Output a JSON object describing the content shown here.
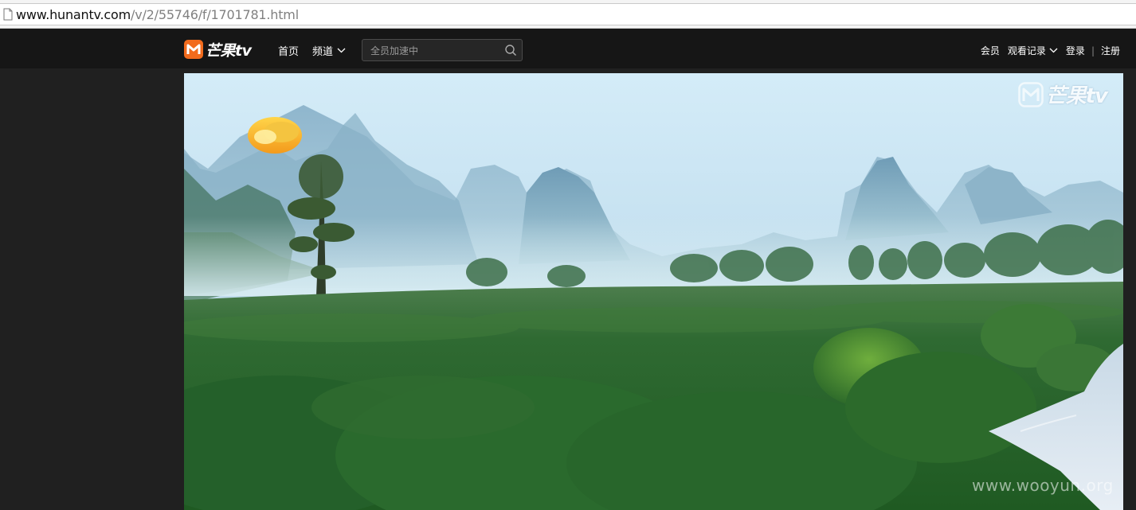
{
  "browser": {
    "url_host": "www.hunantv.com",
    "url_path": "/v/2/55746/f/1701781.html"
  },
  "header": {
    "logo_text": "芒果tv",
    "nav": {
      "home": "首页",
      "channels": "频道"
    },
    "search": {
      "placeholder": "全员加速中"
    },
    "right": {
      "member": "会员",
      "history": "观看记录",
      "login": "登录",
      "separator": "|",
      "register": "注册"
    }
  },
  "video": {
    "watermark_text": "芒果tv"
  },
  "page_watermark": "www.wooyun.org",
  "colors": {
    "brand_orange": "#f26b1d",
    "header_bg": "#161616",
    "page_bg": "#202020"
  },
  "icons": {
    "page": "page-icon",
    "channels_dropdown": "chevron-down-icon",
    "search": "search-icon",
    "history_dropdown": "chevron-down-icon",
    "logo": "mango-tv-logo-icon",
    "channel_logo": "hunan-tv-logo-icon"
  }
}
